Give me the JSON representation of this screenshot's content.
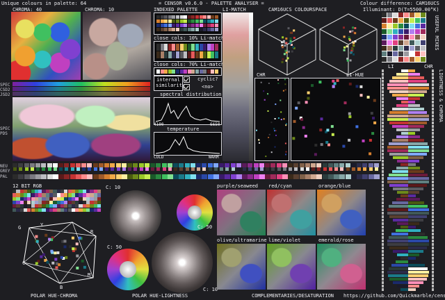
{
  "header": {
    "unique_colours": "Unique colours in palette: 64",
    "app_title": "= CENSOR v0.6.0 - PALETTE ANALYSER =",
    "colour_difference": "Colour difference: CAM16UCS",
    "illuminant": "Illuminant: D(T=5500.00°K)",
    "footer_url": "https://github.com/Quickmarble/censor"
  },
  "labels": {
    "chroma40": "CHROMA: 40",
    "chroma10": "CHROMA: 10",
    "indexed_palette": "INDEXED PALETTE",
    "li_match": "LI-MATCH",
    "cam16ucs_space": "CAM16UCS COLOURSPACE",
    "close_cols_10": "close cols: 10% Li-match",
    "close_cols_70": "close cols: 70% Li-match",
    "internal_similarity": "internal similarity",
    "cyclic": "cyclic?",
    "cyclic_value": "<no>",
    "spectral_distribution": "spectral distribution",
    "spectral_min": "4100",
    "spectral_max": "6650",
    "temperature": "temperature",
    "temp_cold": "COLD",
    "temp_warm": "WARM",
    "chr": "CHR",
    "li_hue": "LI-HUE",
    "li": "LI",
    "chr2": "CHR",
    "useful_mixes": "USEFUL MIXES",
    "lightness_chroma": "LIGHTNESS & CHROMA",
    "spec": "SPEC",
    "csd2": "CSD2",
    "jsd2": "JSD2",
    "spec2": "SPEC",
    "pds": "PDS",
    "neu": "NEU",
    "grey": "GREY",
    "pal": "PAL",
    "bit12": "12 BIT RGB",
    "c10a": "C: 10",
    "c50a": "C: 50",
    "c50b": "C: 50",
    "c10b": "C: 10",
    "polar_hue_chroma": "POLAR HUE-CHROMA",
    "polar_hue_lightness": "POLAR HUE-LIGHTNESS",
    "complementaries": "COMPLEMENTARIES/DESATURATION",
    "purple_seaweed": "purple/seaweed",
    "red_cyan": "red/cyan",
    "orange_blue": "orange/blue",
    "olive_ultramarine": "olive/ultramarine",
    "lime_violet": "lime/violet",
    "emerald_rose": "emerald/rose",
    "hue_g": "G",
    "hue_y": "Y",
    "hue_r": "R",
    "hue_c": "C",
    "hue_m": "M",
    "hue_b": "B"
  },
  "palette": [
    "#2b2b2b",
    "#3d3d42",
    "#5a5a60",
    "#7a7a80",
    "#9b9ba0",
    "#bdbdc2",
    "#dcdcdc",
    "#ffffff",
    "#5b1a1a",
    "#8a2525",
    "#c43232",
    "#e65a5a",
    "#ff8c8c",
    "#ffc0c0",
    "#6b3a1a",
    "#a05a2a",
    "#d68030",
    "#f0a848",
    "#ffd070",
    "#fff0a0",
    "#4a5a10",
    "#6e8a1a",
    "#9ac828",
    "#c8ee50",
    "#1a5a2a",
    "#2a8a40",
    "#40c060",
    "#80e090",
    "#0a4a5a",
    "#1a7a8a",
    "#30b0c0",
    "#80e0f0",
    "#1a2a6a",
    "#2a48a8",
    "#4070e0",
    "#80a8ff",
    "#3a1a6a",
    "#5a2aa0",
    "#8040d0",
    "#b080f0",
    "#5a1a5a",
    "#8a2a8a",
    "#c040c0",
    "#f080f0",
    "#6a1a3a",
    "#a02a5a",
    "#e04080",
    "#ff90b8",
    "#3a2a1a",
    "#5a4030",
    "#806048",
    "#a88068",
    "#d0a890",
    "#f0d0c0",
    "#2a3a3a",
    "#405858",
    "#608080",
    "#88a8a8",
    "#b0d0d0",
    "#1a1a2a",
    "#2a2a48",
    "#404070",
    "#6868a0",
    "#a0a0d0"
  ],
  "colors": {
    "background": "#1e1e22",
    "panel_border": "#d8d8de",
    "text": "#f0f0f4"
  }
}
